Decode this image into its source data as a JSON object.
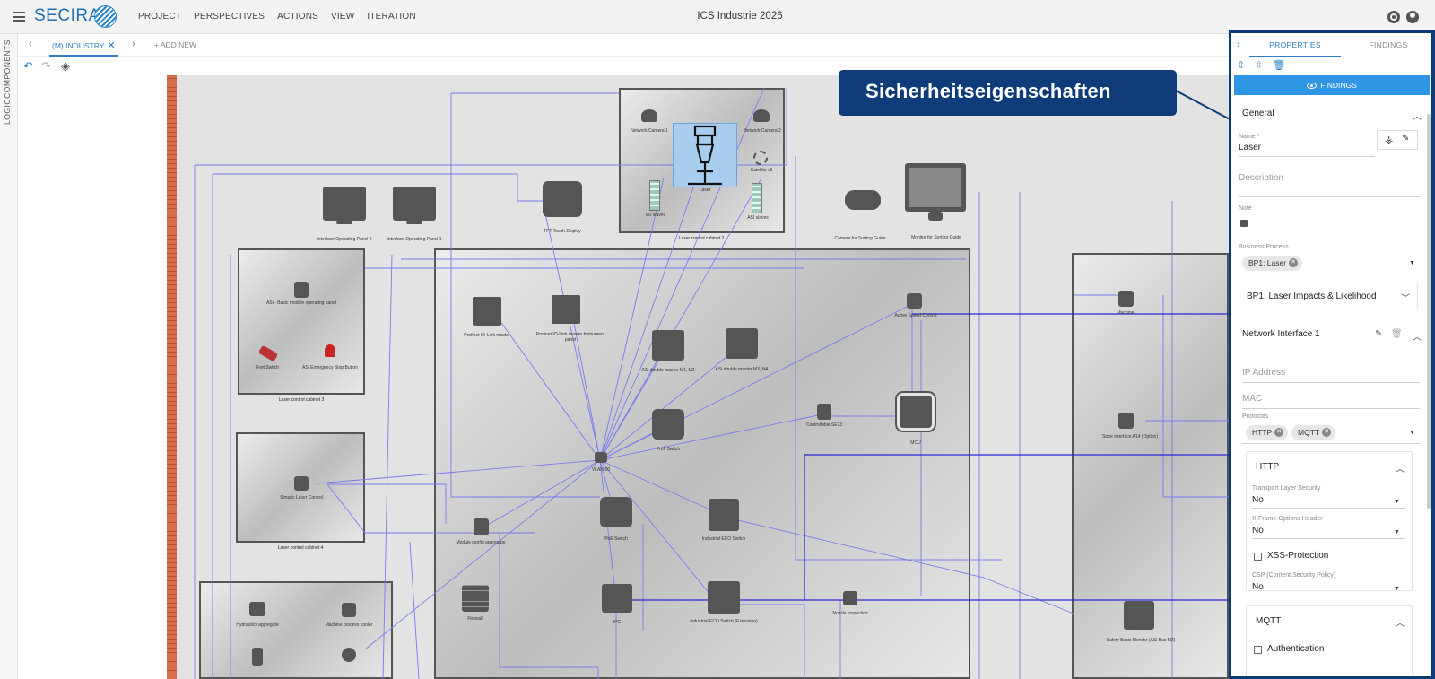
{
  "app": {
    "logo_text": "SECIRA",
    "menu": [
      "PROJECT",
      "PERSPECTIVES",
      "ACTIONS",
      "VIEW",
      "ITERATION"
    ],
    "document_title": "ICS Industrie 2026"
  },
  "left_rail": {
    "tabs": [
      "COMPONENTS",
      "LOGIC"
    ]
  },
  "tabbar": {
    "prev": "‹",
    "active_tab": "(M) INDUSTRY",
    "next": "›",
    "add_new": "+ ADD NEW"
  },
  "canvas": {
    "cabinets": [
      {
        "caption": "Laser control cabinet 2"
      },
      {
        "caption": "Laser control cabinet 3"
      },
      {
        "caption": "Laser control cabinet 4"
      }
    ],
    "labels": {
      "network_camera_1": "Network Camera 1",
      "network_camera_2": "Network Camera 2",
      "laser": "Laser",
      "satellite": "Satellite v3",
      "io_slaves": "I/O slaves",
      "asi_slaves": "ASI slaves",
      "iop2": "Interface Operating Panel 2",
      "iop1": "Interface Operating Panel 1",
      "tft": "TFT Touch Display",
      "camera_sorting": "Camera for Sorting Guide",
      "monitor_sorting": "Monitor for Sorting Guide",
      "asi_basic": "ASi - Basic module operating panel",
      "foot_switch": "Foot Switch",
      "estop": "ASi Emergency Stop Button",
      "profinet_io": "Profinet IO-Link master",
      "profinet_io_instr": "Profinet IO-Link master Instrument panel",
      "asi_m1m2": "ASi double master M1, M2",
      "asi_m3m4": "ASi double master M3, M4",
      "active_speed": "Active Speed Control",
      "mcu": "MCU",
      "controllable": "Controllable SE33",
      "profi_switch": "Profi Switch",
      "vlan": "VLAN-00",
      "simatic": "Simatic Laser Control",
      "module_config": "Module config aggregate",
      "poe": "PoE Switch",
      "eco_switch": "Industrial ECO Switch",
      "firewall": "Firewall",
      "ipc": "IPC",
      "eco_ext": "Industrial ECO Switch (Extension)",
      "nozzle": "Nozzle inspection",
      "hydraulics": "Hydraulics aggregate",
      "machine_process": "Machine process cooler",
      "machine": "Machine",
      "store_interface": "Store interface A14 (Option)",
      "safety_basic": "Safety Basic Monitor (ASi Bus M2)"
    }
  },
  "callout": {
    "text": "Sicherheitseigenschaften"
  },
  "panel": {
    "tabs": {
      "properties": "PROPERTIES",
      "findings": "FINDINGS"
    },
    "findings_button": "FINDINGS",
    "general": {
      "title": "General",
      "name_label": "Name *",
      "name_value": "Laser",
      "description_placeholder": "Description",
      "note_label": "Note",
      "bp_label": "Business Process",
      "bp_chip": "BP1: Laser",
      "impacts_title": "BP1: Laser Impacts & Likelihood"
    },
    "network_interface": {
      "title": "Network Interface 1",
      "ip_placeholder": "IP Address",
      "mac_placeholder": "MAC",
      "protocols_label": "Protocols",
      "protocols": [
        "HTTP",
        "MQTT"
      ]
    },
    "http": {
      "title": "HTTP",
      "tls_label": "Transport Layer Security",
      "tls_value": "No",
      "xframe_label": "X-Frame-Options Header",
      "xframe_value": "No",
      "xss_label": "XSS-Protection",
      "csp_label": "CSP (Content Security Policy)",
      "csp_value": "No"
    },
    "mqtt": {
      "title": "MQTT",
      "auth_label": "Authentication"
    }
  },
  "colors": {
    "accent": "#2b7fc2",
    "callout_bg": "#0d3c78",
    "findings_btn": "#2f96e6",
    "wire": "#7a7af0"
  }
}
